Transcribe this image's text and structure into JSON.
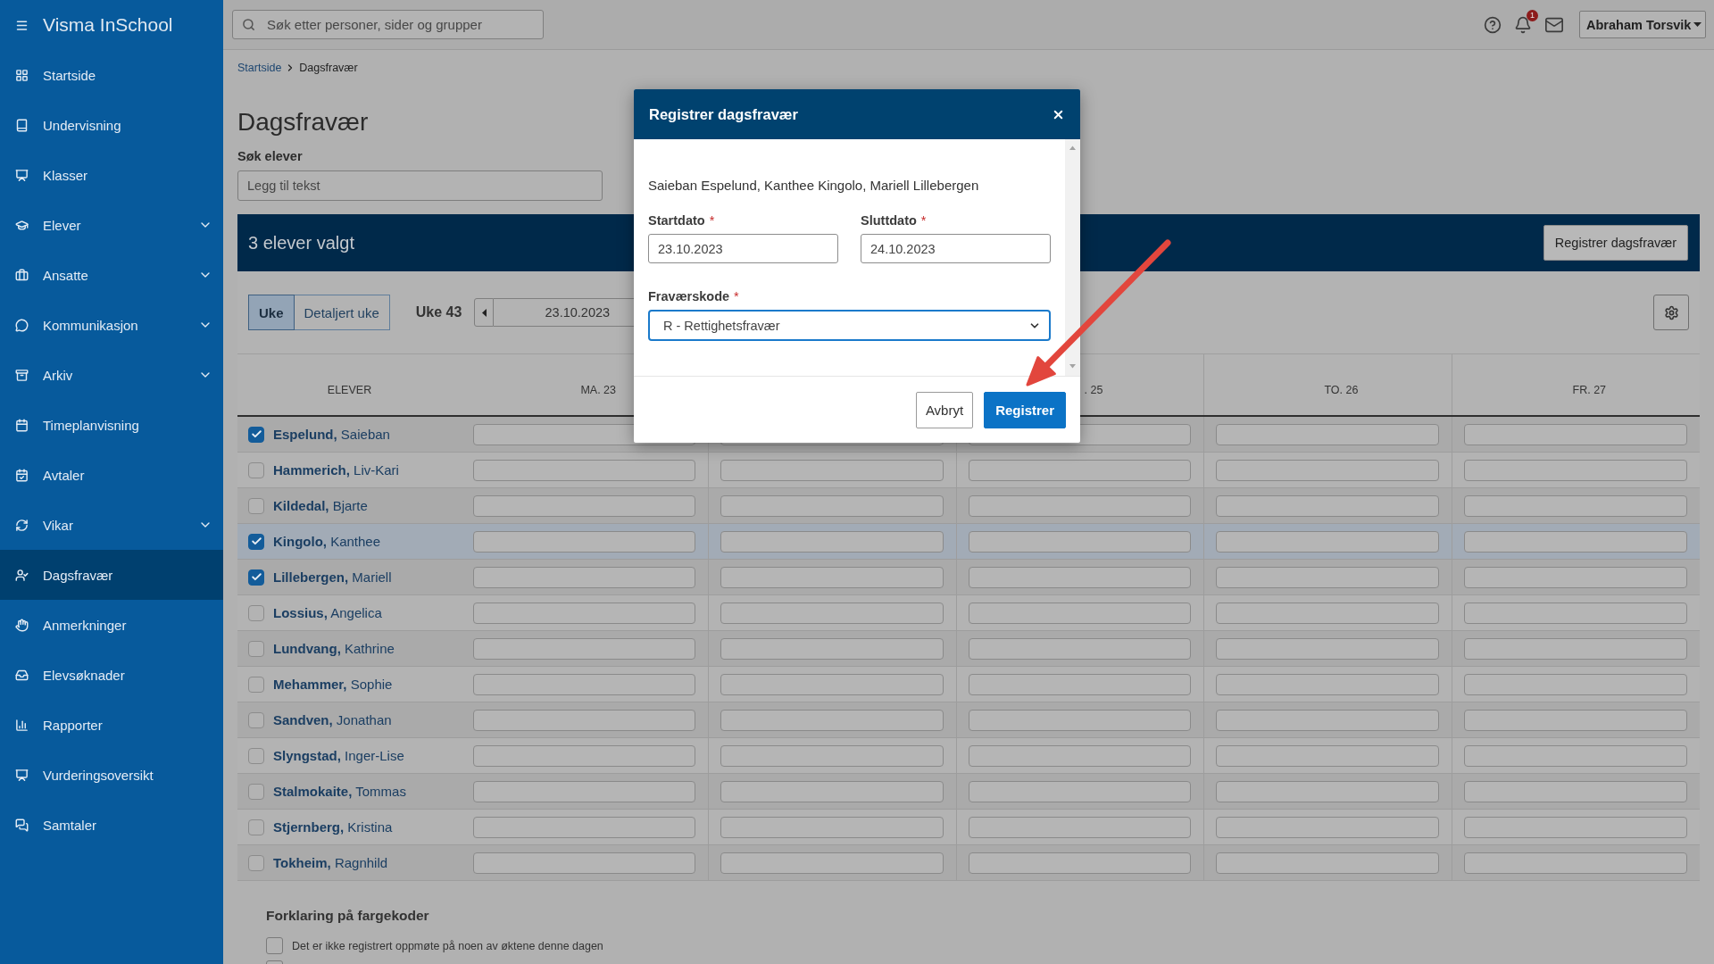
{
  "sidebar": {
    "brand": "Visma InSchool",
    "items": [
      {
        "label": "Startside",
        "expandable": false,
        "selected": false
      },
      {
        "label": "Undervisning",
        "expandable": false,
        "selected": false
      },
      {
        "label": "Klasser",
        "expandable": false,
        "selected": false
      },
      {
        "label": "Elever",
        "expandable": true,
        "selected": false
      },
      {
        "label": "Ansatte",
        "expandable": true,
        "selected": false
      },
      {
        "label": "Kommunikasjon",
        "expandable": true,
        "selected": false
      },
      {
        "label": "Arkiv",
        "expandable": true,
        "selected": false
      },
      {
        "label": "Timeplanvisning",
        "expandable": false,
        "selected": false
      },
      {
        "label": "Avtaler",
        "expandable": false,
        "selected": false
      },
      {
        "label": "Vikar",
        "expandable": true,
        "selected": false
      },
      {
        "label": "Dagsfravær",
        "expandable": false,
        "selected": true
      },
      {
        "label": "Anmerkninger",
        "expandable": false,
        "selected": false
      },
      {
        "label": "Elevsøknader",
        "expandable": false,
        "selected": false
      },
      {
        "label": "Rapporter",
        "expandable": false,
        "selected": false
      },
      {
        "label": "Vurderingsoversikt",
        "expandable": false,
        "selected": false
      },
      {
        "label": "Samtaler",
        "expandable": false,
        "selected": false
      }
    ]
  },
  "header": {
    "search": {
      "placeholder": "Søk etter personer, sider og grupper"
    },
    "notification_count": "1",
    "user": "Abraham Torsvik"
  },
  "breadcrumb": [
    {
      "label": "Startside",
      "kind": "link"
    },
    {
      "label": "Dagsfravær",
      "kind": "current"
    }
  ],
  "page": {
    "title": "Dagsfravær",
    "student_search": {
      "label": "Søk elever",
      "placeholder": "Legg til tekst"
    }
  },
  "selection_bar": {
    "text": "3 elever valgt",
    "button": "Registrer dagsfravær"
  },
  "toolbar": {
    "view_tabs": [
      {
        "label": "Uke",
        "selected": true
      },
      {
        "label": "Detaljert uke",
        "selected": false
      }
    ],
    "week": "Uke 43",
    "date": "23.10.2023"
  },
  "table": {
    "columns": [
      {
        "label": "ELEVER"
      },
      {
        "label": "MA. 23"
      },
      {},
      {
        "label": ". 25"
      },
      {
        "label": "TO. 26"
      },
      {
        "label": "FR. 27"
      }
    ],
    "rows": [
      {
        "name": "**Espelund,** Saieban",
        "checked": true,
        "highlighted": false
      },
      {
        "name": "**Hammerich,** Liv-Kari",
        "checked": false,
        "highlighted": false
      },
      {
        "name": "**Kildedal,** Bjarte",
        "checked": false,
        "highlighted": false
      },
      {
        "name": "**Kingolo,** Kanthee",
        "checked": true,
        "highlighted": true
      },
      {
        "name": "**Lillebergen,** Mariell",
        "checked": true,
        "highlighted": false
      },
      {
        "name": "**Lossius,** Angelica",
        "checked": false,
        "highlighted": false
      },
      {
        "name": "**Lundvang,** Kathrine",
        "checked": false,
        "highlighted": false
      },
      {
        "name": "**Mehammer,** Sophie",
        "checked": false,
        "highlighted": false
      },
      {
        "name": "**Sandven,** Jonathan",
        "checked": false,
        "highlighted": false
      },
      {
        "name": "**Slyngstad,** Inger-Lise",
        "checked": false,
        "highlighted": false
      },
      {
        "name": "**Stalmokaite,** Tommas",
        "checked": false,
        "highlighted": false
      },
      {
        "name": "**Stjernberg,** Kristina",
        "checked": false,
        "highlighted": false
      },
      {
        "name": "**Tokheim,** Ragnhild",
        "checked": false,
        "highlighted": false
      }
    ]
  },
  "legend": {
    "title": "Forklaring på fargekoder",
    "items": [
      {
        "text": "Det er ikke registrert oppmøte på noen av øktene denne dagen",
        "color": "#b3b3b3"
      },
      {
        "color": "#b3b3b3"
      }
    ]
  },
  "dialog": {
    "title": "Registrer dagsfravær",
    "students": "Saieban Espelund, Kanthee Kingolo, Mariell Lillebergen",
    "fields": [
      {
        "kind": "text",
        "label": "Startdato",
        "required_mark": "*",
        "value": "23.10.2023",
        "focused": false
      },
      {
        "kind": "text",
        "label": "Sluttdato",
        "required_mark": "*",
        "value": "24.10.2023",
        "focused": false
      },
      {
        "kind": "select",
        "label": "Fraværskode",
        "required_mark": "*",
        "value": "R - Rettighetsfravær",
        "focused": true
      }
    ],
    "buttons": [
      {
        "label": "Avbryt",
        "kind": "secondary"
      },
      {
        "label": "Registrer",
        "kind": "primary"
      }
    ]
  }
}
